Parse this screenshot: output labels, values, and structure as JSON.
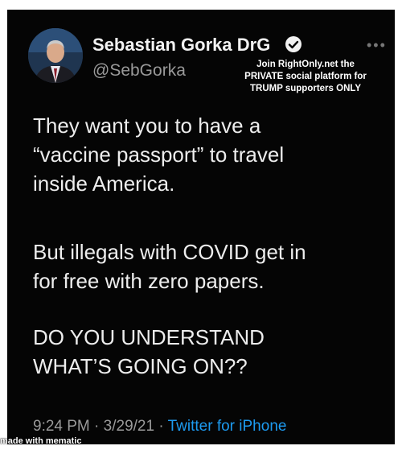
{
  "tweet": {
    "display_name": "Sebastian Gorka DrG",
    "handle": "@SebGorka",
    "paragraphs": [
      [
        "They want you to have a",
        "“vaccine passport” to travel",
        "inside America."
      ],
      [
        "But illegals with COVID get in",
        "for free with zero papers."
      ],
      [
        "DO YOU UNDERSTAND",
        "WHAT’S GOING ON??"
      ]
    ],
    "time": "9:24 PM",
    "date": "3/29/21",
    "source": "Twitter for iPhone",
    "separator": " · "
  },
  "overlay": {
    "promo_lines": [
      "Join RightOnly.net the",
      "PRIVATE social platform for",
      "TRUMP supporters ONLY"
    ],
    "watermark": "made with mematic"
  },
  "icons": {
    "verified": "verified-badge-icon",
    "more": "more-options-icon"
  },
  "colors": {
    "background": "#050505",
    "text": "#ededed",
    "muted": "#9a9a9a",
    "link": "#1d9bf0"
  }
}
